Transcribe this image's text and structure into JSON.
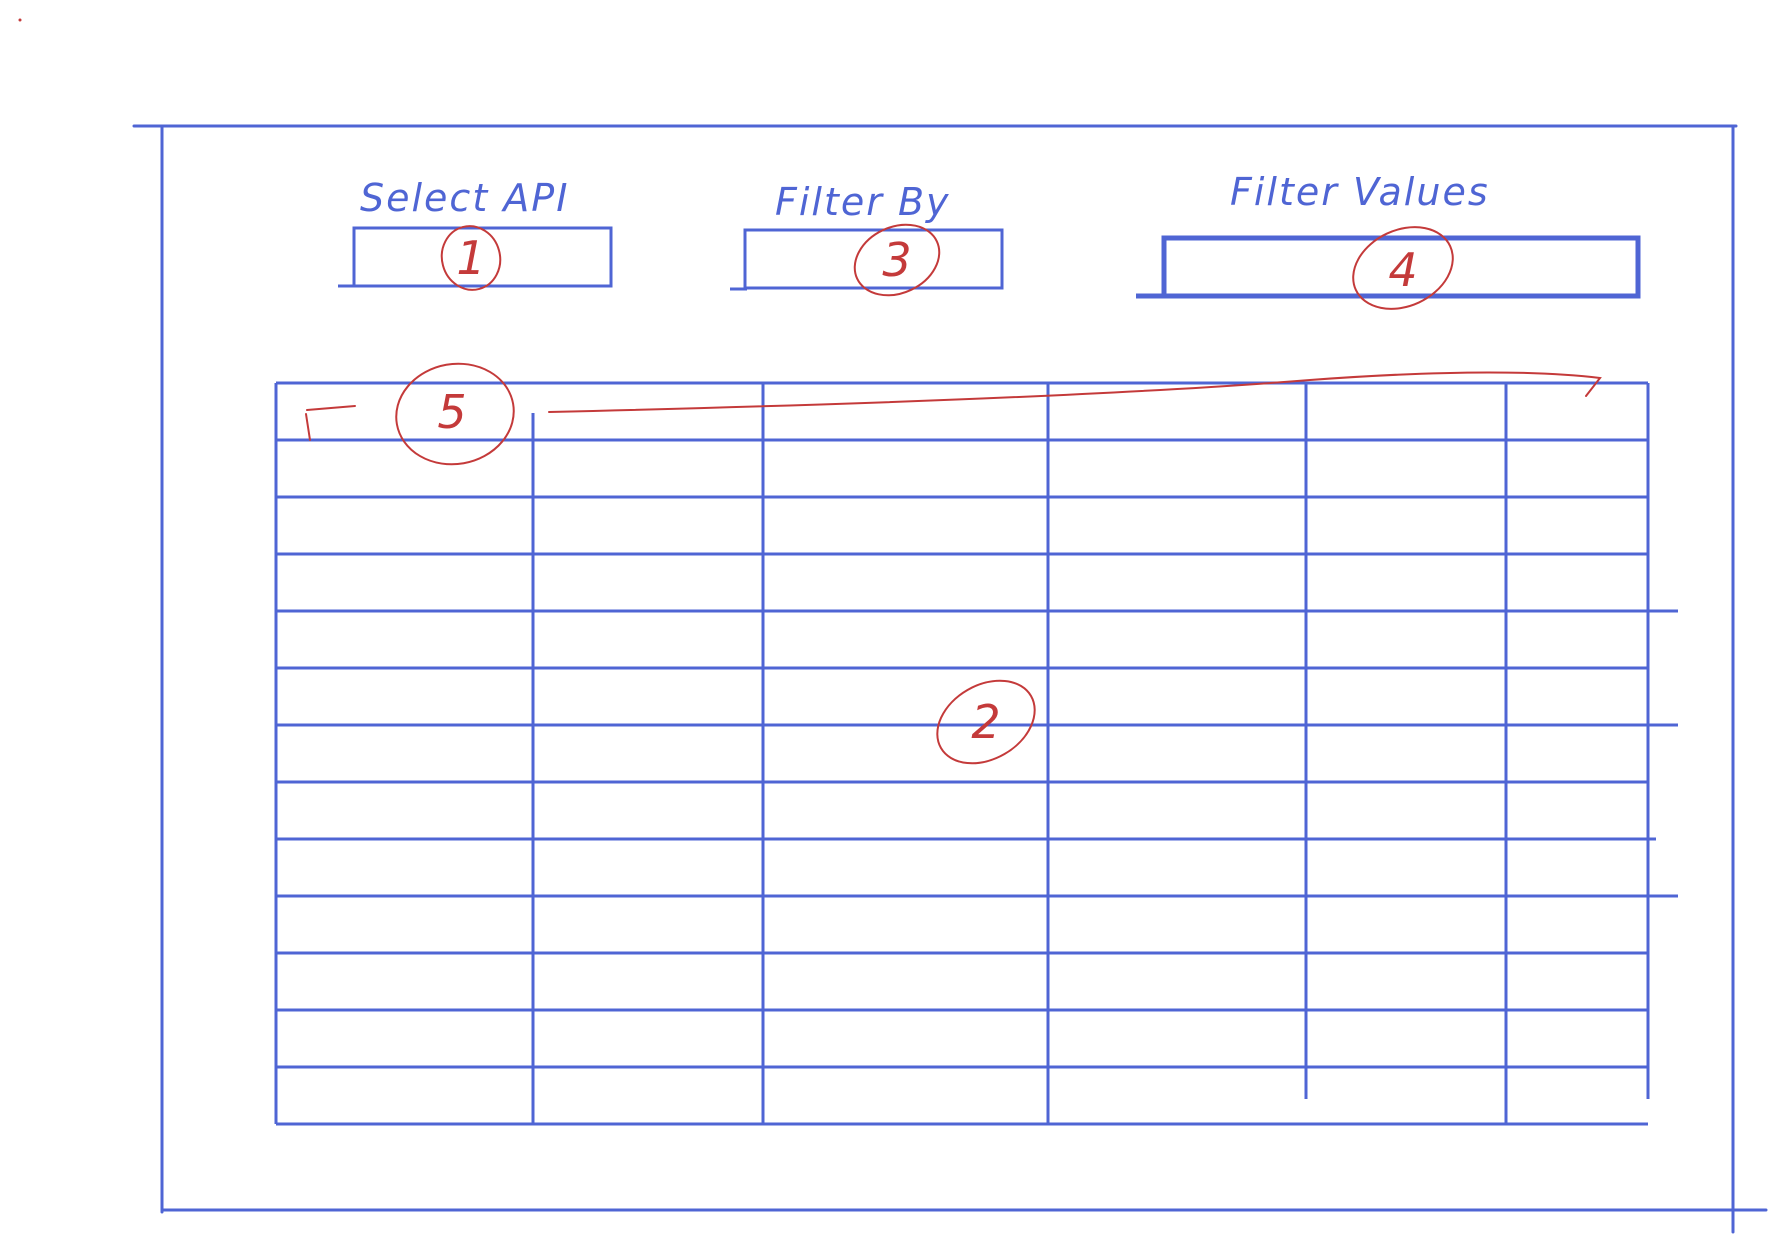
{
  "filters": {
    "select_api_label": "Select API",
    "filter_by_label": "Filter By",
    "filter_values_label": "Filter Values"
  },
  "callouts": {
    "select_api": "1",
    "results_table": "2",
    "filter_by": "3",
    "filter_values": "4",
    "table_header": "5"
  },
  "colors": {
    "ink": "#4f65d4",
    "annotation": "#c43a3a"
  }
}
